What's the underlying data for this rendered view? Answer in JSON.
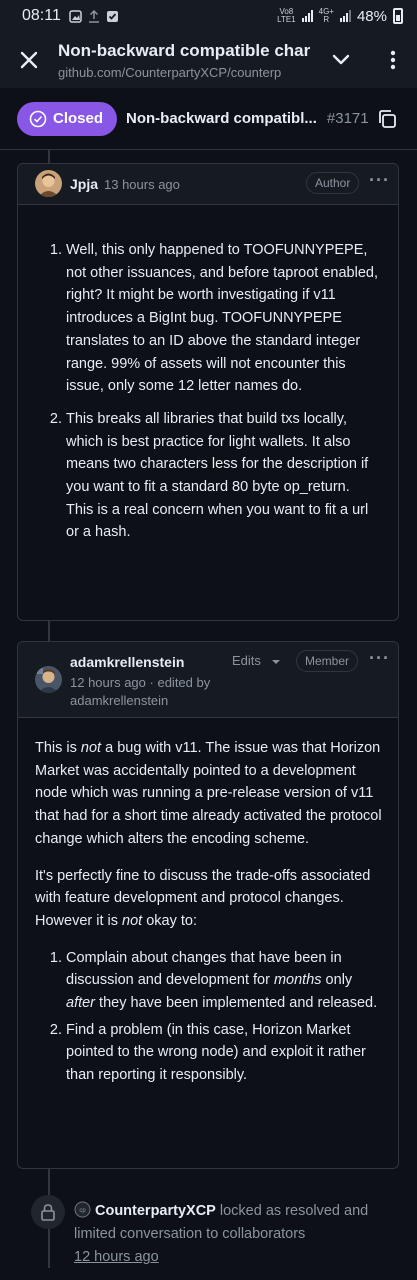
{
  "status_bar": {
    "time": "08:11",
    "network_top": "Vo8",
    "network_bottom": "LTE1",
    "network2_top": "4G+",
    "network2_bottom": "R",
    "battery": "48%"
  },
  "browser": {
    "page_title": "Non-backward compatible char",
    "url": "github.com/CounterpartyXCP/counterp"
  },
  "issue": {
    "state": "Closed",
    "title": "Non-backward compatibl...",
    "number": "#3171"
  },
  "comments": [
    {
      "author": "Jpja",
      "time": "13 hours ago",
      "role": "Author",
      "items": [
        "Well, this only happened to TOOFUNNYPEPE, not other issuances, and before taproot enabled, right? It might be worth investigating if v11 introduces a BigInt bug. TOOFUNNYPEPE translates to an ID above the standard integer range. 99% of assets will not encounter this issue, only some 12 letter names do.",
        "This breaks all libraries that build txs locally, which is best practice for light wallets. It also means two characters less for the description if you want to fit a standard 80 byte op_return. This is a real concern when you want to fit a url or a hash."
      ]
    },
    {
      "author": "adamkrellenstein",
      "time": "12 hours ago",
      "edited_by": "· edited by",
      "editor": "adamkrellenstein",
      "edits_label": "Edits",
      "role": "Member",
      "p1_a": "This is ",
      "p1_em": "not",
      "p1_b": " a bug with v11. The issue was that Horizon Market was accidentally pointed to a development node which was running a pre-release version of v11 that had for a short time already activated the protocol change which alters the encoding scheme.",
      "p2_a": "It's perfectly fine to discuss the trade-offs associated with feature development and protocol changes. However it is ",
      "p2_em": "not",
      "p2_b": " okay to:",
      "li1_a": "Complain about changes that have been in discussion and development for ",
      "li1_em1": "months",
      "li1_b": " only ",
      "li1_em2": "after",
      "li1_c": " they have been implemented and released.",
      "li2": "Find a problem (in this case, Horizon Market pointed to the wrong node) and exploit it rather than reporting it responsibly."
    }
  ],
  "event": {
    "actor": "CounterpartyXCP",
    "text": " locked as resolved and limited conversation to collaborators",
    "time": "12 hours ago"
  },
  "colors": {
    "background": "#0d1117",
    "header": "#161b22",
    "border": "#30363d",
    "closed_badge": "#8957e5",
    "muted_text": "#8b949e"
  }
}
